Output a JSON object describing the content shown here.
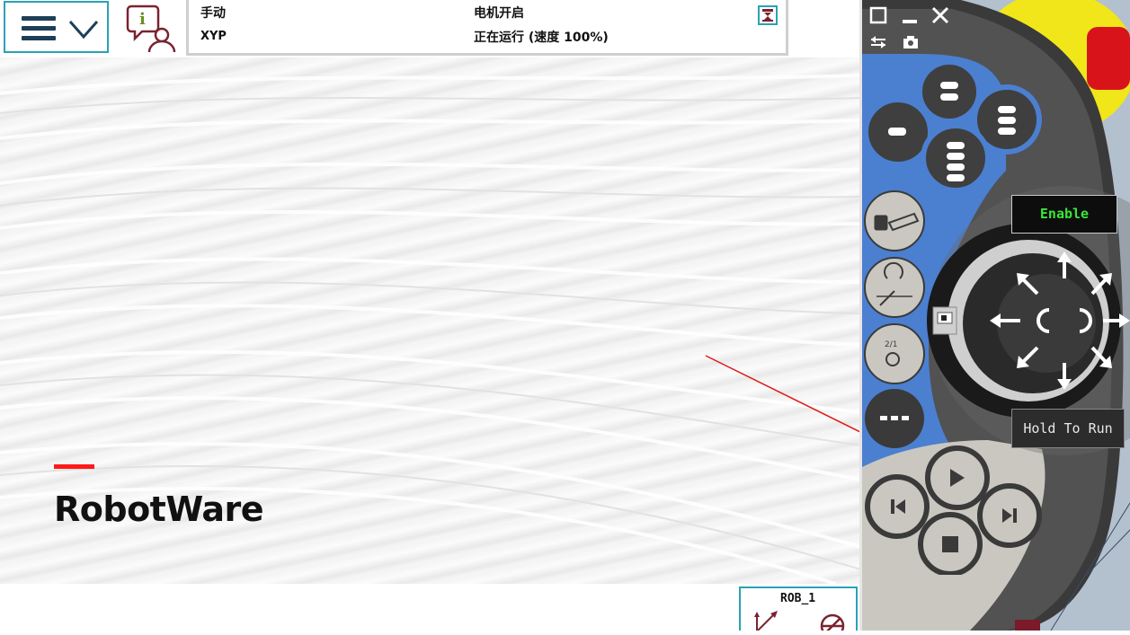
{
  "menu": {
    "icon": "hamburger-menu-icon",
    "chevron_icon": "chevron-down-icon"
  },
  "info": {
    "icon": "info-user-icon"
  },
  "status": {
    "mode": "手动",
    "system_name": "XYP",
    "motor_state": "电机开启",
    "run_state": "正在运行 (速度 100%)",
    "icon": "robot-status-icon"
  },
  "splash": {
    "brand": "RobotWare"
  },
  "quickset": {
    "unit": "ROB_1",
    "jog_icon": "jog-axes-icon",
    "speed_icon": "speed-override-icon"
  },
  "pendant": {
    "window_buttons": [
      "maximize-icon",
      "minimize-icon",
      "close-icon",
      "swap-icon",
      "camera-icon"
    ],
    "enable_label": "Enable",
    "hold_label": "Hold To Run",
    "colors": {
      "accent": "#2aa2b5",
      "pendant_blue": "#4b7fd0",
      "enable_text": "#39e639",
      "arrow": "#e01a1a"
    }
  }
}
